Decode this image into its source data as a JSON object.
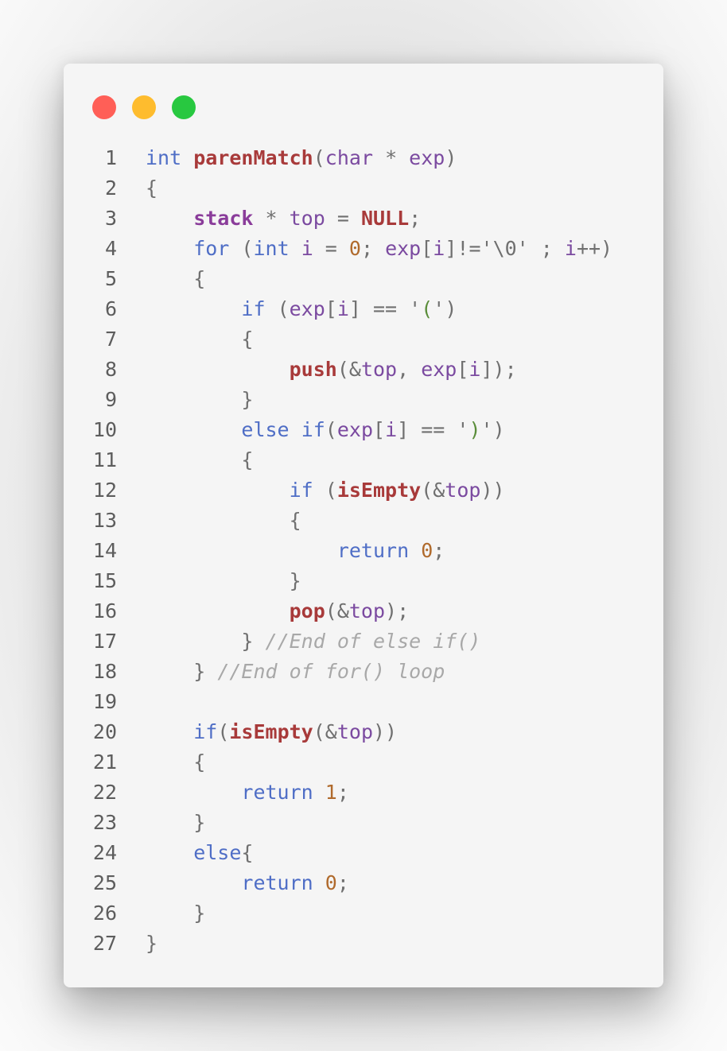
{
  "window": {
    "traffic_lights": [
      {
        "name": "close",
        "color": "#ff5f57"
      },
      {
        "name": "minimize",
        "color": "#febc2e"
      },
      {
        "name": "maximize",
        "color": "#28c840"
      }
    ]
  },
  "colors": {
    "keyword": "#4f6ec6",
    "function": "#a83a3a",
    "type": "#8a3c9a",
    "identifier": "#7b4aa0",
    "number": "#b06a2c",
    "punctuation": "#707070",
    "string": "#5a8d3a",
    "comment": "#a8a8a8"
  },
  "code_lines": [
    {
      "num": "1",
      "indent": 0,
      "tokens": [
        [
          "kw",
          "int"
        ],
        [
          "pu",
          " "
        ],
        [
          "fn",
          "parenMatch"
        ],
        [
          "pu",
          "("
        ],
        [
          "id",
          "char"
        ],
        [
          "pu",
          " * "
        ],
        [
          "id",
          "exp"
        ],
        [
          "pu",
          ")"
        ]
      ]
    },
    {
      "num": "2",
      "indent": 0,
      "tokens": [
        [
          "pu",
          "{"
        ]
      ]
    },
    {
      "num": "3",
      "indent": 1,
      "tokens": [
        [
          "ty",
          "stack"
        ],
        [
          "pu",
          " * "
        ],
        [
          "id",
          "top"
        ],
        [
          "pu",
          " = "
        ],
        [
          "fn",
          "NULL"
        ],
        [
          "pu",
          ";"
        ]
      ]
    },
    {
      "num": "4",
      "indent": 1,
      "tokens": [
        [
          "kw",
          "for"
        ],
        [
          "pu",
          " ("
        ],
        [
          "kw",
          "int"
        ],
        [
          "pu",
          " "
        ],
        [
          "id",
          "i"
        ],
        [
          "pu",
          " = "
        ],
        [
          "nm",
          "0"
        ],
        [
          "pu",
          "; "
        ],
        [
          "id",
          "exp"
        ],
        [
          "pu",
          "["
        ],
        [
          "id",
          "i"
        ],
        [
          "pu",
          "]!='\\0' ; "
        ],
        [
          "id",
          "i"
        ],
        [
          "pu",
          "++)"
        ]
      ]
    },
    {
      "num": "5",
      "indent": 1,
      "tokens": [
        [
          "pu",
          "{"
        ]
      ]
    },
    {
      "num": "6",
      "indent": 2,
      "tokens": [
        [
          "kw",
          "if"
        ],
        [
          "pu",
          " ("
        ],
        [
          "id",
          "exp"
        ],
        [
          "pu",
          "["
        ],
        [
          "id",
          "i"
        ],
        [
          "pu",
          "] == '"
        ],
        [
          "st",
          "("
        ],
        [
          "pu",
          "')"
        ]
      ]
    },
    {
      "num": "7",
      "indent": 2,
      "tokens": [
        [
          "pu",
          "{"
        ]
      ]
    },
    {
      "num": "8",
      "indent": 3,
      "tokens": [
        [
          "fn",
          "push"
        ],
        [
          "pu",
          "(&"
        ],
        [
          "id",
          "top"
        ],
        [
          "pu",
          ", "
        ],
        [
          "id",
          "exp"
        ],
        [
          "pu",
          "["
        ],
        [
          "id",
          "i"
        ],
        [
          "pu",
          "]);"
        ]
      ]
    },
    {
      "num": "9",
      "indent": 2,
      "tokens": [
        [
          "pu",
          "}"
        ]
      ]
    },
    {
      "num": "10",
      "indent": 2,
      "tokens": [
        [
          "kw",
          "else"
        ],
        [
          "pu",
          " "
        ],
        [
          "kw",
          "if"
        ],
        [
          "pu",
          "("
        ],
        [
          "id",
          "exp"
        ],
        [
          "pu",
          "["
        ],
        [
          "id",
          "i"
        ],
        [
          "pu",
          "] == '"
        ],
        [
          "st",
          ")"
        ],
        [
          "pu",
          "')"
        ]
      ]
    },
    {
      "num": "11",
      "indent": 2,
      "tokens": [
        [
          "pu",
          "{"
        ]
      ]
    },
    {
      "num": "12",
      "indent": 3,
      "tokens": [
        [
          "kw",
          "if"
        ],
        [
          "pu",
          " ("
        ],
        [
          "fn",
          "isEmpty"
        ],
        [
          "pu",
          "(&"
        ],
        [
          "id",
          "top"
        ],
        [
          "pu",
          "))"
        ]
      ]
    },
    {
      "num": "13",
      "indent": 3,
      "tokens": [
        [
          "pu",
          "{"
        ]
      ]
    },
    {
      "num": "14",
      "indent": 4,
      "tokens": [
        [
          "kw",
          "return"
        ],
        [
          "pu",
          " "
        ],
        [
          "nm",
          "0"
        ],
        [
          "pu",
          ";"
        ]
      ]
    },
    {
      "num": "15",
      "indent": 3,
      "tokens": [
        [
          "pu",
          "}"
        ]
      ]
    },
    {
      "num": "16",
      "indent": 3,
      "tokens": [
        [
          "fn",
          "pop"
        ],
        [
          "pu",
          "(&"
        ],
        [
          "id",
          "top"
        ],
        [
          "pu",
          ");"
        ]
      ]
    },
    {
      "num": "17",
      "indent": 2,
      "tokens": [
        [
          "pu",
          "} "
        ],
        [
          "cm",
          "//End of else if()"
        ]
      ]
    },
    {
      "num": "18",
      "indent": 1,
      "tokens": [
        [
          "pu",
          "} "
        ],
        [
          "cm",
          "//End of for() loop"
        ]
      ]
    },
    {
      "num": "19",
      "indent": 0,
      "tokens": []
    },
    {
      "num": "20",
      "indent": 1,
      "tokens": [
        [
          "kw",
          "if"
        ],
        [
          "pu",
          "("
        ],
        [
          "fn",
          "isEmpty"
        ],
        [
          "pu",
          "(&"
        ],
        [
          "id",
          "top"
        ],
        [
          "pu",
          "))"
        ]
      ]
    },
    {
      "num": "21",
      "indent": 1,
      "tokens": [
        [
          "pu",
          "{"
        ]
      ]
    },
    {
      "num": "22",
      "indent": 2,
      "tokens": [
        [
          "kw",
          "return"
        ],
        [
          "pu",
          " "
        ],
        [
          "nm",
          "1"
        ],
        [
          "pu",
          ";"
        ]
      ]
    },
    {
      "num": "23",
      "indent": 1,
      "tokens": [
        [
          "pu",
          "}"
        ]
      ]
    },
    {
      "num": "24",
      "indent": 1,
      "tokens": [
        [
          "kw",
          "else"
        ],
        [
          "pu",
          "{"
        ]
      ]
    },
    {
      "num": "25",
      "indent": 2,
      "tokens": [
        [
          "kw",
          "return"
        ],
        [
          "pu",
          " "
        ],
        [
          "nm",
          "0"
        ],
        [
          "pu",
          ";"
        ]
      ]
    },
    {
      "num": "26",
      "indent": 1,
      "tokens": [
        [
          "pu",
          "}"
        ]
      ]
    },
    {
      "num": "27",
      "indent": 0,
      "tokens": [
        [
          "pu",
          "}"
        ]
      ]
    }
  ]
}
